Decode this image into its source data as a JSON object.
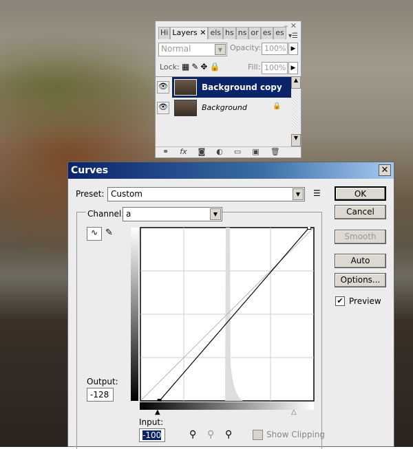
{
  "layers_panel": {
    "tabs": [
      "Hi",
      "Layers",
      "els",
      "hs",
      "ns",
      "or",
      "es",
      "es"
    ],
    "blend_mode": "Normal",
    "opacity_label": "Opacity:",
    "opacity": "100%",
    "lock_label": "Lock:",
    "fill_label": "Fill:",
    "fill": "100%",
    "layers": [
      {
        "name": "Background copy",
        "selected": true,
        "visible": true
      },
      {
        "name": "Background",
        "selected": false,
        "visible": true,
        "locked": true
      }
    ]
  },
  "curves": {
    "title": "Curves",
    "preset_label": "Preset:",
    "preset": "Custom",
    "channel_label": "Channel:",
    "channel": "a",
    "output_label": "Output:",
    "output": "-128",
    "input_label": "Input:",
    "input": "-100",
    "show_clipping": "Show Clipping",
    "buttons": {
      "ok": "OK",
      "cancel": "Cancel",
      "smooth": "Smooth",
      "auto": "Auto",
      "options": "Options..."
    },
    "preview_label": "Preview",
    "preview_checked": true,
    "curve_points": [
      [
        -128,
        -128
      ],
      [
        -100,
        -128
      ],
      [
        120,
        127
      ],
      [
        127,
        127
      ]
    ]
  }
}
